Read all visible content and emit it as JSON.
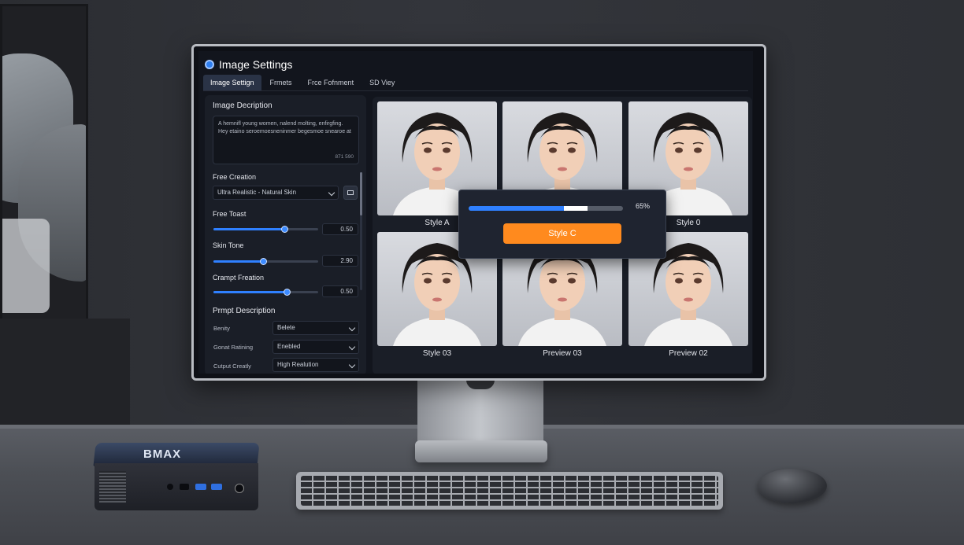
{
  "app": {
    "title": "Image Settings"
  },
  "tabs": [
    "Image Settign",
    "Frmets",
    "Frce Fofnment",
    "SD Viey"
  ],
  "left": {
    "desc_header": "Image Decription",
    "desc_text": "A hemnifl young women, nalend molting, enfirgfing. Hey etaino seroemoesneninmer begesmoe snearoe at",
    "desc_count": "871 590",
    "free_creation": {
      "label": "Free Creation",
      "value": "Ultra Realistic - Natural Skin"
    },
    "sliders": [
      {
        "label": "Free Toast",
        "value": "0.50",
        "fraction": 0.68
      },
      {
        "label": "Skin Tone",
        "value": "2.90",
        "fraction": 0.48
      },
      {
        "label": "Crampt Freation",
        "value": "0.50",
        "fraction": 0.7
      }
    ],
    "prompt_header": "Prmpt Description",
    "prompt_rows": [
      {
        "label": "Benity",
        "value": "Belete"
      },
      {
        "label": "Gonat Ratining",
        "value": "Enebled"
      },
      {
        "label": "Cutput Creatly",
        "value": "High Realution"
      }
    ]
  },
  "gallery": {
    "captions": [
      "Style A",
      "",
      "Style 0",
      "Style 03",
      "Preview 03",
      "Preview 02"
    ]
  },
  "overlay": {
    "percent_label": "65%",
    "progress": 0.77,
    "button_label": "Style C"
  },
  "device": {
    "brand": "BMAX"
  },
  "colors": {
    "accent": "#2f80ff",
    "orange": "#ff8a1e",
    "panel": "#1a1e27"
  }
}
